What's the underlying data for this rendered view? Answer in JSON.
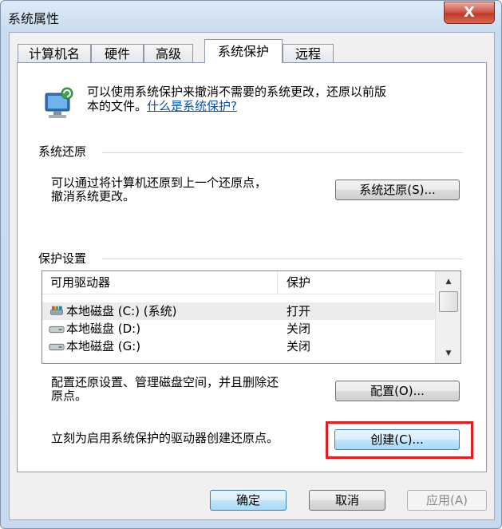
{
  "window": {
    "title": "系统属性",
    "close_label": "X"
  },
  "tabs": [
    {
      "label": "计算机名"
    },
    {
      "label": "硬件"
    },
    {
      "label": "高级"
    },
    {
      "label": "系统保护"
    },
    {
      "label": "远程"
    }
  ],
  "intro": {
    "line1": "可以使用系统保护来撤消不需要的系统更改，还原以前版",
    "line2": "本的文件。",
    "link": "什么是系统保护?"
  },
  "restore": {
    "section_title": "系统还原",
    "desc_line1": "可以通过将计算机还原到上一个还原点，",
    "desc_line2": "撤消系统更改。",
    "button": "系统还原(S)..."
  },
  "protection": {
    "section_title": "保护设置",
    "columns": [
      "可用驱动器",
      "保护"
    ],
    "drives": [
      {
        "name": "本地磁盘 (C:) (系统)",
        "status": "打开"
      },
      {
        "name": "本地磁盘 (D:)",
        "status": "关闭"
      },
      {
        "name": "本地磁盘 (G:)",
        "status": "关闭"
      }
    ],
    "config_text_line1": "配置还原设置、管理磁盘空间，并且删除还",
    "config_text_line2": "原点。",
    "config_button": "配置(O)...",
    "create_text": "立刻为启用系统保护的驱动器创建还原点。",
    "create_button": "创建(C)..."
  },
  "footer": {
    "ok": "确定",
    "cancel": "取消",
    "apply": "应用(A)"
  },
  "colors": {
    "highlight": "#e02020",
    "link": "#0a54a8",
    "close": "#c0382a"
  }
}
